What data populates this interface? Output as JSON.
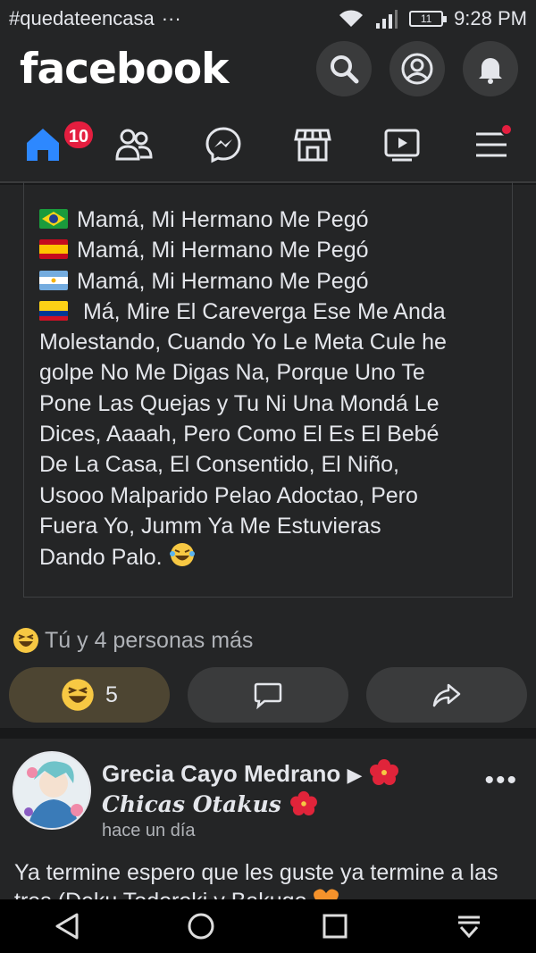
{
  "status": {
    "hashtag": "#quedateencasa",
    "dots": "···",
    "battery": "11",
    "time": "9:28 PM"
  },
  "header": {
    "logo": "facebook",
    "home_badge": "10"
  },
  "post": {
    "lines": [
      "Mamá, Mi Hermano Me Pegó",
      "Mamá, Mi Hermano Me Pegó",
      "Mamá, Mi Hermano Me Pegó",
      " Má, Mire El Careverga Ese Me Anda",
      "Molestando, Cuando Yo Le Meta Cule he",
      "golpe No Me Digas Na, Porque Uno Te",
      "Pone Las Quejas y Tu Ni Una Mondá Le",
      "Dices, Aaaah, Pero Como El Es El Bebé",
      "De La Casa, El Consentido, El Niño,",
      "Usooo Malparido Pelao Adoctao, Pero",
      "Fuera Yo, Jumm Ya Me Estuvieras",
      "Dando Palo."
    ],
    "reactions_text": "Tú y 4 personas más",
    "reaction_count": "5"
  },
  "post2": {
    "author": "Grecia Cayo Medrano",
    "group": "Chicas Otakus",
    "time": "hace un día",
    "text": "Ya termine espero que les guste ya termine a las tres (Deku Todoroki y Bakugo"
  },
  "icons": {
    "home": "home-icon",
    "friends": "friends-icon",
    "messenger": "messenger-icon",
    "marketplace": "marketplace-icon",
    "watch": "watch-icon",
    "menu": "menu-icon"
  },
  "colors": {
    "accent": "#2d88ff",
    "badge": "#e41e3f",
    "surface": "#242526",
    "background": "#18191a"
  }
}
